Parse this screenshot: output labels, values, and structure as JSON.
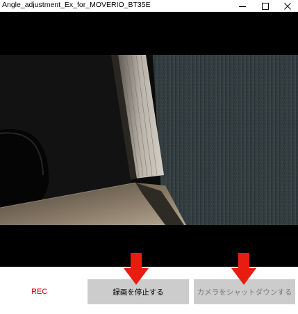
{
  "window": {
    "title": "Angle_adjustment_Ex_for_MOVERIO_BT35E",
    "controls": [
      "minimize-icon",
      "maximize-icon",
      "close-icon"
    ]
  },
  "video": {
    "content": "live camera preview"
  },
  "controls": {
    "rec_label": "REC",
    "stop_recording_label": "録画を停止する",
    "shutdown_camera_label": "カメラをシャットダウンする"
  },
  "annotations": {
    "arrow_icons": [
      "down-arrow-icon",
      "down-arrow-icon"
    ]
  },
  "colors": {
    "rec_text": "#d10000",
    "button_bg": "#cccccc",
    "disabled_text": "#7a7a7a",
    "arrow": "#e81c0f"
  }
}
